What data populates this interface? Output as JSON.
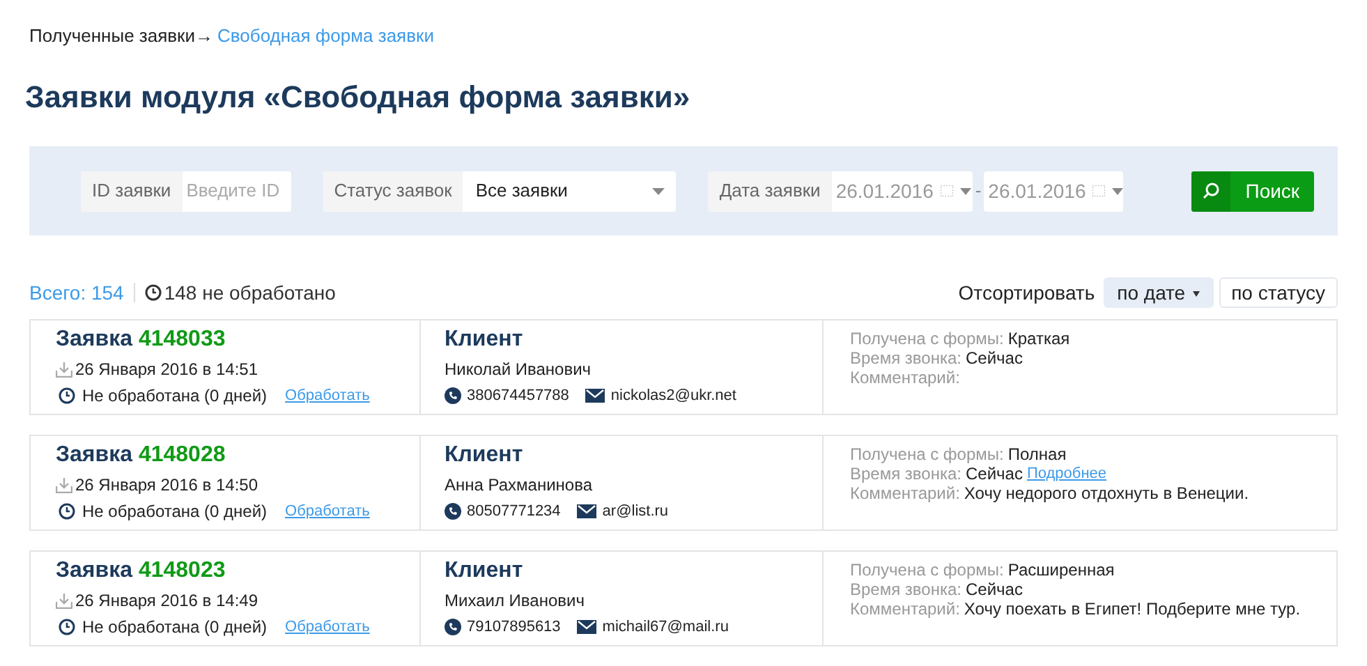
{
  "breadcrumb": {
    "parent": "Полученные заявки",
    "separator": "→",
    "current": "Свободная форма заявки"
  },
  "title": "Заявки модуля «Свободная форма заявки»",
  "filters": {
    "id_label": "ID заявки",
    "id_placeholder": "Введите ID",
    "status_label": "Статус заявок",
    "status_value": "Все заявки",
    "date_label": "Дата заявки",
    "date_from": "26.01.2016",
    "date_dash": "-",
    "date_to": "26.01.2016",
    "search_button": "Поиск"
  },
  "summary": {
    "total": "Всего: 154",
    "unprocessed": "148 не обработано"
  },
  "sort": {
    "label": "Отсортировать",
    "options": [
      {
        "label": "по дате",
        "selected": true
      },
      {
        "label": "по статусу",
        "selected": false
      }
    ]
  },
  "requests": [
    {
      "title": "Заявка",
      "number": "4148033",
      "date": "26 Января 2016 в 14:51",
      "status": "Не обработана (0 дней)",
      "action": "Обработать",
      "client_heading": "Клиент",
      "client_name": "Николай Иванович",
      "phone": "380674457788",
      "email": "nickolas2@ukr.net",
      "details": [
        {
          "label": "Получена с формы:",
          "value": "Краткая"
        },
        {
          "label": "Время звонка:",
          "value": "Сейчас"
        },
        {
          "label": "Комментарий:"
        }
      ]
    },
    {
      "title": "Заявка",
      "number": "4148028",
      "date": "26 Января 2016 в 14:50",
      "status": "Не обработана (0 дней)",
      "action": "Обработать",
      "client_heading": "Клиент",
      "client_name": "Анна Рахманинова",
      "phone": "80507771234",
      "email": "ar@list.ru",
      "details": [
        {
          "label": "Получена с формы:",
          "value": "Полная"
        },
        {
          "label": "Время звонка:",
          "value": "Сейчас",
          "link": "Подробнее"
        },
        {
          "label": "Комментарий:",
          "value": "Хочу недорого отдохнуть в Венеции."
        }
      ]
    },
    {
      "title": "Заявка",
      "number": "4148023",
      "date": "26 Января 2016 в 14:49",
      "status": "Не обработана (0 дней)",
      "action": "Обработать",
      "client_heading": "Клиент",
      "client_name": "Михаил Иванович",
      "phone": "79107895613",
      "email": "michail67@mail.ru",
      "details": [
        {
          "label": "Получена с формы:",
          "value": "Расширенная"
        },
        {
          "label": "Время звонка:",
          "value": "Сейчас"
        },
        {
          "label": "Комментарий:",
          "value": "Хочу поехать в Египет! Подберите мне тур."
        }
      ]
    }
  ]
}
